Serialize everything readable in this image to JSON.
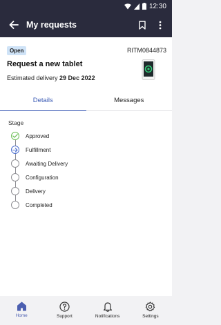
{
  "status_bar": {
    "time": "12:30"
  },
  "app_bar": {
    "title": "My requests"
  },
  "request": {
    "status_badge": "Open",
    "ticket_number": "RITM0844873",
    "title": "Request a new tablet",
    "delivery_label": "Estimated delivery",
    "delivery_date": "29 Dec 2022"
  },
  "tabs": [
    {
      "label": "Details",
      "active": true
    },
    {
      "label": "Messages",
      "active": false
    }
  ],
  "stage_heading": "Stage",
  "stages": [
    {
      "label": "Approved",
      "state": "done"
    },
    {
      "label": "Fulfillment",
      "state": "current"
    },
    {
      "label": "Awaiting Delivery",
      "state": "pending"
    },
    {
      "label": "Configuration",
      "state": "pending"
    },
    {
      "label": "Delivery",
      "state": "pending"
    },
    {
      "label": "Completed",
      "state": "pending"
    }
  ],
  "bottom_nav": [
    {
      "label": "Home",
      "icon": "home-icon",
      "active": true
    },
    {
      "label": "Support",
      "icon": "help-icon",
      "active": false
    },
    {
      "label": "Notifications",
      "icon": "bell-icon",
      "active": false
    },
    {
      "label": "Settings",
      "icon": "gear-icon",
      "active": false
    }
  ],
  "colors": {
    "header_bg": "#2a2b3d",
    "accent": "#3b5bb5",
    "done": "#6cbf55",
    "badge_bg": "#cfe3f7"
  }
}
